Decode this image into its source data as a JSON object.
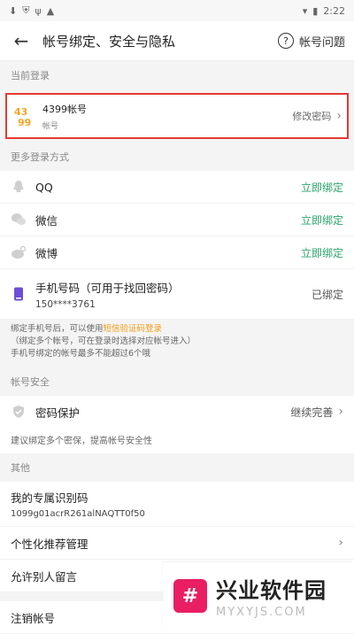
{
  "status": {
    "time": "2:22"
  },
  "header": {
    "title": "帐号绑定、安全与隐私",
    "help_label": "帐号问题"
  },
  "sections": {
    "current_login": "当前登录",
    "more_login": "更多登录方式",
    "account_security": "帐号安全",
    "other": "其他"
  },
  "current_account": {
    "title": "4399帐号",
    "subtitle": "帐号",
    "action": "修改密码"
  },
  "login_methods": [
    {
      "label": "QQ",
      "action": "立即绑定"
    },
    {
      "label": "微信",
      "action": "立即绑定"
    },
    {
      "label": "微博",
      "action": "立即绑定"
    }
  ],
  "phone": {
    "label": "手机号码（可用于找回密码）",
    "number": "150****3761",
    "status": "已绑定",
    "note_prefix": "绑定手机号后，可以使用",
    "note_link": "短信验证码登录",
    "note_suffix": "（绑定多个帐号，可在登录时选择对应帐号进入）",
    "note_line2": "手机号绑定的帐号最多不能超过6个哦"
  },
  "security": {
    "label": "密码保护",
    "action": "继续完善",
    "note": "建议绑定多个密保，提高帐号安全性"
  },
  "other": {
    "id_label": "我的专属识别码",
    "id_value": "1099g01acrR261alNAQTT0f50",
    "recommend_label": "个性化推荐管理",
    "allow_label": "允许别人留言",
    "cancel_label": "注销帐号"
  },
  "watermark": {
    "brand_cn": "兴业软件园",
    "brand_en": "MYXYJS.COM"
  }
}
